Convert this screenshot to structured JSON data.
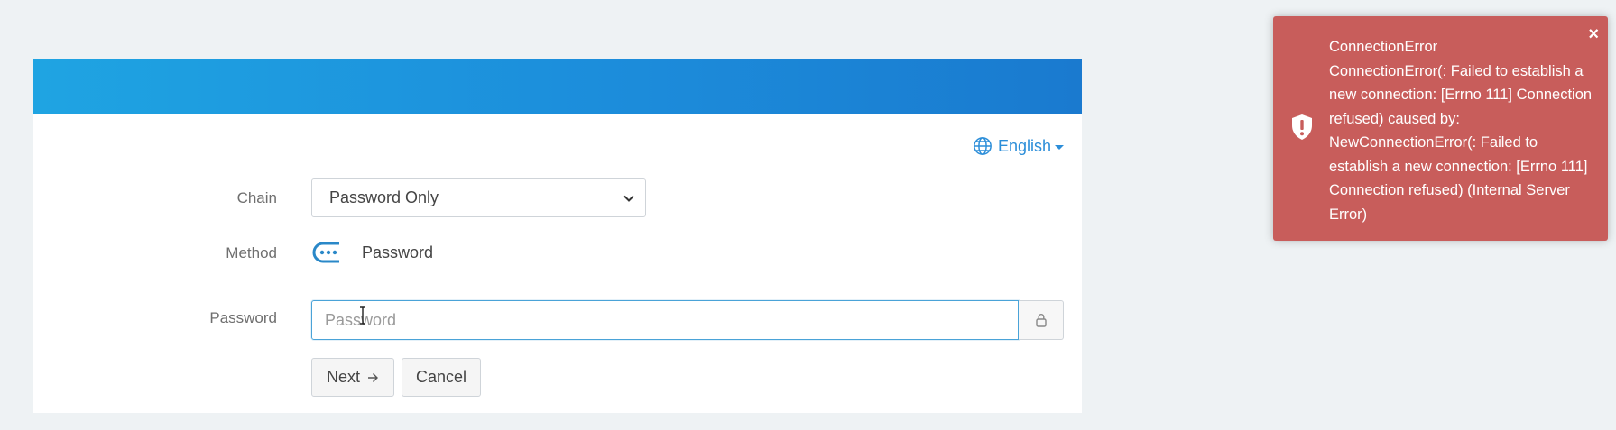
{
  "header": {
    "language_label": "English",
    "language_icon": "globe-icon"
  },
  "form": {
    "chain_label": "Chain",
    "chain_selected": "Password Only",
    "method_label": "Method",
    "method_value": "Password",
    "method_icon": "password-dots-icon",
    "password_label": "Password",
    "password_value": "",
    "password_placeholder": "Password",
    "password_addon_icon": "lock-icon",
    "next_label": "Next",
    "next_icon": "arrow-right-icon",
    "cancel_label": "Cancel"
  },
  "toast": {
    "title": "ConnectionError",
    "message": "ConnectionError(: Failed to establish a new connection: [Errno 111] Connection refused) caused by: NewConnectionError(: Failed to establish a new connection: [Errno 111] Connection refused) (Internal Server Error)",
    "icon": "shield-exclamation-icon",
    "close_label": "×"
  },
  "colors": {
    "header_gradient_start": "#1fa4e2",
    "header_gradient_end": "#1a7acf",
    "accent": "#2c8ed9",
    "toast_background": "#c85d5b",
    "page_background": "#eef2f4"
  }
}
